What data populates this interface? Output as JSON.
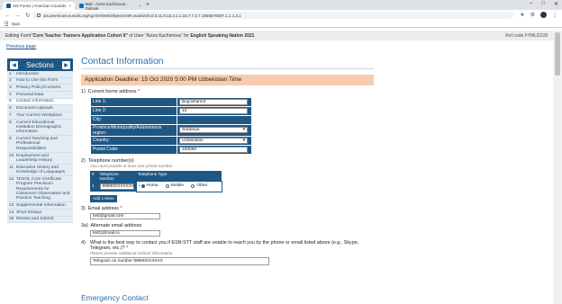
{
  "browser": {
    "tabs": [
      {
        "label": "AIS Forms | American Councils",
        "active": true
      },
      {
        "label": "Mail - Aziza Kuchimova - Outlook",
        "active": false
      }
    ],
    "new_tab": "+",
    "url": "ais.americancouncils.org/cgi-bin/WebObjects/AIR.woa/wo/0.0.0.11.9.13.3.1.1.15.7.7.3.7.1656876607.1.1.1.3.1",
    "bookmarks_label": "Apps",
    "controls": {
      "minimize": "–",
      "maximize": "□",
      "close": "✕"
    },
    "icons": {
      "back": "←",
      "forward": "→",
      "reload": "↻",
      "star": "★",
      "extensions": "⚙",
      "menu": "⋮"
    }
  },
  "form_bar": {
    "title_prefix": "Editing Form ",
    "form_name": "\"Core Teacher Trainers Application Cohort II\"",
    "of_user": " of User ",
    "user": "\"Aziza Kuchimova\"",
    "for_label": " for ",
    "program": "English Speaking Nation 2021",
    "ref_code": "Ref code FYMU2228"
  },
  "previous_page": "Previous page",
  "sidebar": {
    "title": "Sections",
    "prev_arrow": "◀",
    "next_arrow": "▶",
    "items": [
      {
        "num": "1",
        "label": "Introduction"
      },
      {
        "num": "2",
        "label": "How to Use this Form"
      },
      {
        "num": "3",
        "label": "Privacy Policy/Consent"
      },
      {
        "num": "4",
        "label": "Personal Data"
      },
      {
        "num": "5",
        "label": "Contact Information"
      },
      {
        "num": "6",
        "label": "Document Uploads"
      },
      {
        "num": "7",
        "label": "Your Current Workplace"
      },
      {
        "num": "8",
        "label": "Current Educational Institution Demographic Information"
      },
      {
        "num": "9",
        "label": "Current Teaching and Professional Responsibilities"
      },
      {
        "num": "10",
        "label": "Employment and Leadership History"
      },
      {
        "num": "11",
        "label": "Education History and Knowledge of Languages"
      },
      {
        "num": "12",
        "label": "TESOL Core Certificate Program Practicum Requirements for Classroom Observation and Practice Teaching"
      },
      {
        "num": "13",
        "label": "Supplemental Information"
      },
      {
        "num": "14",
        "label": "Short Essays"
      },
      {
        "num": "15",
        "label": "Review and Submit"
      }
    ]
  },
  "main": {
    "title": "Contact Information",
    "deadline": "Application Deadline: 15 Oct 2020 5:00 PM Uzbekistan Time",
    "q1": {
      "num": "1)",
      "label": "Current home address",
      "required": "*"
    },
    "address": [
      {
        "label": "Line 1:",
        "value": "Bog'ishamol",
        "type": "text"
      },
      {
        "label": "Line 2:",
        "value": "12",
        "type": "text"
      },
      {
        "label": "City:",
        "value": "",
        "type": "none"
      },
      {
        "label": "Province/Municipality/Autonomous region:",
        "value": "Surdarya",
        "type": "select"
      },
      {
        "label": "Country:",
        "value": "Uzbekistan",
        "type": "select"
      },
      {
        "label": "Postal Code:",
        "value": "100098",
        "type": "text"
      }
    ],
    "q2": {
      "num": "2)",
      "label": "Telephone number(s)",
      "hint": "You must provide at least one phone number"
    },
    "phone": {
      "col_num": "#",
      "col_number": "Telephone Number",
      "col_type": "Telephone Type",
      "row_num": "1",
      "row_required": "*",
      "number": "99890XXXXXXX",
      "type_required": "*",
      "types": [
        {
          "label": "Home",
          "checked": true
        },
        {
          "label": "Mobile",
          "checked": false
        },
        {
          "label": "Other",
          "checked": false
        }
      ]
    },
    "add_more": "Add 1 More",
    "q3": {
      "num": "3)",
      "label": "Email address",
      "required": "*",
      "value": "test@gmail.com"
    },
    "q3a": {
      "num": "3a)",
      "label": "Alternate email address",
      "value": "test1@mail.ru"
    },
    "q4": {
      "num": "4)",
      "label": "What is the best way to contact you if ESN:STT staff are unable to reach you by the phone or email listed above (e.g., Skype, Telegram, etc.)?",
      "required": "*",
      "hint": "Please provide additional contact information.",
      "value": "Telegram on number 99890XXXXXX"
    },
    "next_section": "Emergency Contact"
  },
  "colors": {
    "accent": "#1e5784",
    "title": "#2e6da4",
    "deadline_bg": "#f8cbad",
    "required": "#cc0000"
  }
}
